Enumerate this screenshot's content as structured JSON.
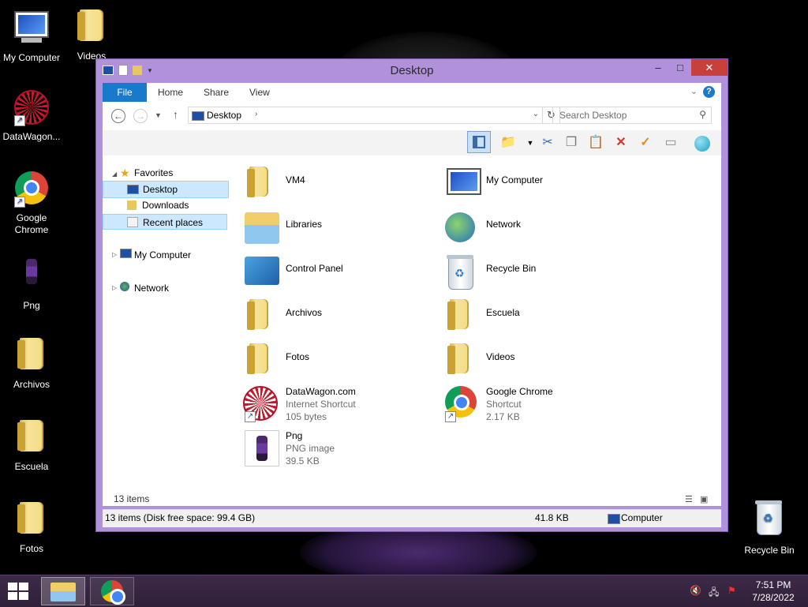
{
  "desktop": {
    "icons": [
      {
        "label": "My Computer"
      },
      {
        "label": "Videos"
      },
      {
        "label": "DataWagon..."
      },
      {
        "label": "Google Chrome"
      },
      {
        "label": "Png"
      },
      {
        "label": "Archivos"
      },
      {
        "label": "Escuela"
      },
      {
        "label": "Fotos"
      },
      {
        "label": "Recycle Bin"
      }
    ]
  },
  "window": {
    "title": "Desktop",
    "controls": {
      "minimize": "–",
      "maximize": "□",
      "close": "✕"
    },
    "ribbon_tabs": [
      "File",
      "Home",
      "Share",
      "View"
    ],
    "address": {
      "path": "Desktop"
    },
    "search": {
      "placeholder": "Search Desktop"
    },
    "nav": {
      "favorites": "Favorites",
      "desktop": "Desktop",
      "downloads": "Downloads",
      "recent": "Recent places",
      "my_computer": "My Computer",
      "network": "Network"
    },
    "items": [
      {
        "name": "VM4"
      },
      {
        "name": "My Computer"
      },
      {
        "name": "Libraries"
      },
      {
        "name": "Network"
      },
      {
        "name": "Control Panel"
      },
      {
        "name": "Recycle Bin"
      },
      {
        "name": "Archivos"
      },
      {
        "name": "Escuela"
      },
      {
        "name": "Fotos"
      },
      {
        "name": "Videos"
      },
      {
        "name": "DataWagon.com",
        "type": "Internet Shortcut",
        "size": "105 bytes"
      },
      {
        "name": "Google Chrome",
        "type": "Shortcut",
        "size": "2.17 KB"
      },
      {
        "name": "Png",
        "type": "PNG image",
        "size": "39.5 KB"
      }
    ],
    "item_count": "13 items",
    "status": {
      "left": "13 items (Disk free space: 99.4 GB)",
      "size": "41.8 KB",
      "location": "Computer"
    }
  },
  "taskbar": {
    "time": "7:51 PM",
    "date": "7/28/2022"
  }
}
